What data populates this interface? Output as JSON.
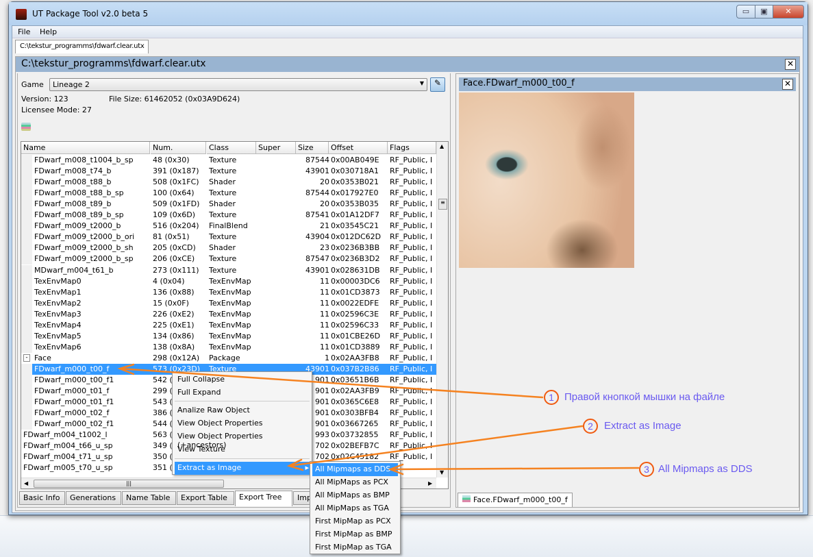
{
  "window": {
    "title": "UT Package Tool v2.0 beta 5",
    "controls": [
      "minimize",
      "maximize",
      "close"
    ]
  },
  "menu": [
    "File",
    "Help"
  ],
  "doc_tab": "C:\\tekstur_programms\\fdwarf.clear.utx",
  "doc_header": "C:\\tekstur_programms\\fdwarf.clear.utx",
  "info": {
    "game_label": "Game",
    "game_value": "Lineage 2",
    "version": "Version: 123",
    "file_size": "File Size: 61462052 (0x03A9D624)",
    "licensee": "Licensee Mode: 27"
  },
  "table": {
    "columns": [
      "Name",
      "Num.",
      "Class",
      "Super",
      "Size",
      "Offset",
      "Flags"
    ],
    "rows": [
      {
        "name": "FDwarf_m008_t1004_b_sp",
        "num": "48 (0x30)",
        "class": "Texture",
        "size": "87544",
        "offset": "0x00AB049E",
        "flags": "RF_Public, I",
        "indent": 1
      },
      {
        "name": "FDwarf_m008_t74_b",
        "num": "391 (0x187)",
        "class": "Texture",
        "size": "43901",
        "offset": "0x030718A1",
        "flags": "RF_Public, I",
        "indent": 1
      },
      {
        "name": "FDwarf_m008_t88_b",
        "num": "508 (0x1FC)",
        "class": "Shader",
        "size": "20",
        "offset": "0x0353B021",
        "flags": "RF_Public, I",
        "indent": 1
      },
      {
        "name": "FDwarf_m008_t88_b_sp",
        "num": "100 (0x64)",
        "class": "Texture",
        "size": "87544",
        "offset": "0x017927E0",
        "flags": "RF_Public, I",
        "indent": 1
      },
      {
        "name": "FDwarf_m008_t89_b",
        "num": "509 (0x1FD)",
        "class": "Shader",
        "size": "20",
        "offset": "0x0353B035",
        "flags": "RF_Public, I",
        "indent": 1
      },
      {
        "name": "FDwarf_m008_t89_b_sp",
        "num": "109 (0x6D)",
        "class": "Texture",
        "size": "87541",
        "offset": "0x01A12DF7",
        "flags": "RF_Public, I",
        "indent": 1
      },
      {
        "name": "FDwarf_m009_t2000_b",
        "num": "516 (0x204)",
        "class": "FinalBlend",
        "size": "21",
        "offset": "0x03545C21",
        "flags": "RF_Public, I",
        "indent": 1
      },
      {
        "name": "FDwarf_m009_t2000_b_ori",
        "num": "81 (0x51)",
        "class": "Texture",
        "size": "43904",
        "offset": "0x012DC62D",
        "flags": "RF_Public, I",
        "indent": 1
      },
      {
        "name": "FDwarf_m009_t2000_b_sh",
        "num": "205 (0xCD)",
        "class": "Shader",
        "size": "23",
        "offset": "0x0236B3BB",
        "flags": "RF_Public, I",
        "indent": 1
      },
      {
        "name": "FDwarf_m009_t2000_b_sp",
        "num": "206 (0xCE)",
        "class": "Texture",
        "size": "87547",
        "offset": "0x0236B3D2",
        "flags": "RF_Public, I",
        "indent": 1
      },
      {
        "name": "MDwarf_m004_t61_b",
        "num": "273 (0x111)",
        "class": "Texture",
        "size": "43901",
        "offset": "0x028631DB",
        "flags": "RF_Public, I",
        "indent": 1
      },
      {
        "name": "TexEnvMap0",
        "num": "4 (0x04)",
        "class": "TexEnvMap",
        "size": "11",
        "offset": "0x00003DC6",
        "flags": "RF_Public, I",
        "indent": 1
      },
      {
        "name": "TexEnvMap1",
        "num": "136 (0x88)",
        "class": "TexEnvMap",
        "size": "11",
        "offset": "0x01CD3873",
        "flags": "RF_Public, I",
        "indent": 1
      },
      {
        "name": "TexEnvMap2",
        "num": "15 (0x0F)",
        "class": "TexEnvMap",
        "size": "11",
        "offset": "0x0022EDFE",
        "flags": "RF_Public, I",
        "indent": 1
      },
      {
        "name": "TexEnvMap3",
        "num": "226 (0xE2)",
        "class": "TexEnvMap",
        "size": "11",
        "offset": "0x02596C3E",
        "flags": "RF_Public, I",
        "indent": 1
      },
      {
        "name": "TexEnvMap4",
        "num": "225 (0xE1)",
        "class": "TexEnvMap",
        "size": "11",
        "offset": "0x02596C33",
        "flags": "RF_Public, I",
        "indent": 1
      },
      {
        "name": "TexEnvMap5",
        "num": "134 (0x86)",
        "class": "TexEnvMap",
        "size": "11",
        "offset": "0x01CBE26D",
        "flags": "RF_Public, I",
        "indent": 1
      },
      {
        "name": "TexEnvMap6",
        "num": "138 (0x8A)",
        "class": "TexEnvMap",
        "size": "11",
        "offset": "0x01CD3889",
        "flags": "RF_Public, I",
        "indent": 1
      },
      {
        "name": "Face",
        "num": "298 (0x12A)",
        "class": "Package",
        "size": "1",
        "offset": "0x02AA3FB8",
        "flags": "RF_Public, I",
        "indent": 0,
        "expander": "-"
      },
      {
        "name": "FDwarf_m000_t00_f",
        "num": "573 (0x23D)",
        "class": "Texture",
        "size": "43901",
        "offset": "0x037B2B86",
        "flags": "RF_Public, I",
        "indent": 1,
        "selected": true
      },
      {
        "name": "FDwarf_m000_t00_f1",
        "num": "542 (",
        "class": "",
        "size": "901",
        "offset": "0x03651B6B",
        "flags": "RF_Public, I",
        "indent": 1
      },
      {
        "name": "FDwarf_m000_t01_f",
        "num": "299 (",
        "class": "",
        "size": "901",
        "offset": "0x02AA3FB9",
        "flags": "RF_Public, I",
        "indent": 1
      },
      {
        "name": "FDwarf_m000_t01_f1",
        "num": "543 (",
        "class": "",
        "size": "901",
        "offset": "0x0365C6E8",
        "flags": "RF_Public, I",
        "indent": 1
      },
      {
        "name": "FDwarf_m000_t02_f",
        "num": "386 (",
        "class": "",
        "size": "901",
        "offset": "0x0303BFB4",
        "flags": "RF_Public, I",
        "indent": 1
      },
      {
        "name": "FDwarf_m000_t02_f1",
        "num": "544 (",
        "class": "",
        "size": "901",
        "offset": "0x03667265",
        "flags": "RF_Public, I",
        "indent": 1
      },
      {
        "name": "FDwarf_m004_t1002_l",
        "num": "563 (",
        "class": "",
        "size": "993",
        "offset": "0x03732855",
        "flags": "RF_Public, I",
        "indent": 0
      },
      {
        "name": "FDwarf_m004_t66_u_sp",
        "num": "349 (",
        "class": "",
        "size": "702",
        "offset": "0x02BEFB7C",
        "flags": "RF_Public, I",
        "indent": 0
      },
      {
        "name": "FDwarf_m004_t71_u_sp",
        "num": "350 (",
        "class": "",
        "size": "702",
        "offset": "0x02C45182",
        "flags": "RF_Public, I",
        "indent": 0
      },
      {
        "name": "FDwarf_m005_t70_u_sp",
        "num": "351 (",
        "class": "",
        "size": "",
        "offset": "",
        "flags": "",
        "indent": 0
      }
    ]
  },
  "bottom_tabs": [
    "Basic Info",
    "Generations",
    "Name Table",
    "Export Table",
    "Export Tree",
    "Impo"
  ],
  "active_bottom_tab": "Export Tree",
  "preview": {
    "title": "Face.FDwarf_m000_t00_f",
    "tab": "Face.FDwarf_m000_t00_f"
  },
  "context_menu": {
    "items": [
      "Full Collapse",
      "Full Expand",
      "Analize Raw Object",
      "View Object Properties",
      "View Object Properties (+ancestors)",
      "View Texture",
      "Extract as Image"
    ],
    "highlighted": "Extract as Image"
  },
  "submenu": {
    "items": [
      "All Mipmaps as DDS",
      "All MipMaps as PCX",
      "All MipMaps as BMP",
      "All MipMaps as TGA",
      "First MipMap as PCX",
      "First MipMap as BMP",
      "First MipMap as TGA"
    ],
    "highlighted": "All Mipmaps as DDS"
  },
  "annotations": [
    {
      "num": "1",
      "text": "Правой кнопкой мышки на файле"
    },
    {
      "num": "2",
      "text": "Extract as Image"
    },
    {
      "num": "3",
      "text": "All Mipmaps as DDS"
    }
  ],
  "colors": {
    "selection": "#3399ff",
    "header": "#99b4d1",
    "annotation_line": "#f58220",
    "annotation_text": "#6a5af0"
  }
}
